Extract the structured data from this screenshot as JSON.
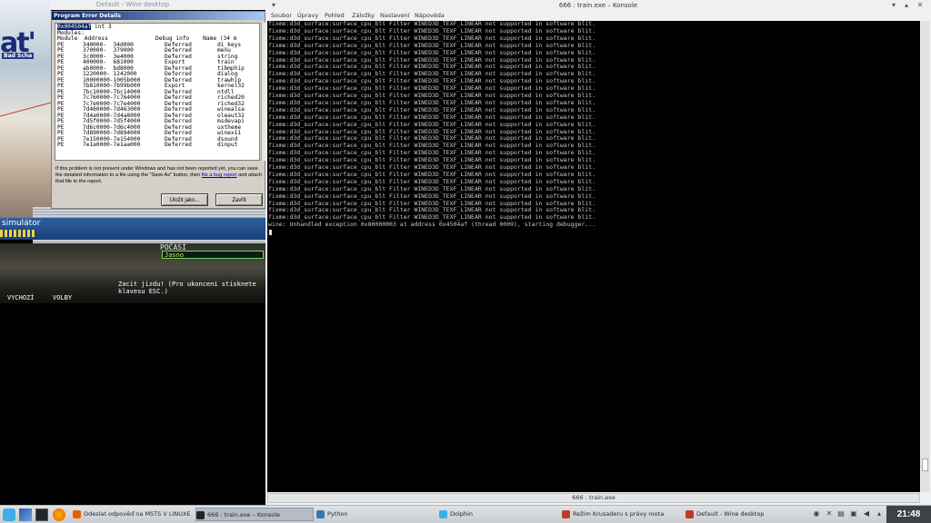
{
  "wine": {
    "window_title": "Default - Wine desktop",
    "game": {
      "logo": "at'",
      "place": "Bad Scha",
      "sim_label": "simulátor",
      "pocasi_label": "POČASÍ",
      "pocasi_value": "Jasno",
      "start_msg": "Zacit jizdu! (Pro ukonceni stisknete\nklavesu ESC.)",
      "vychozi": "VYCHOZÍ",
      "volby": "VOLBY"
    },
    "error_dialog": {
      "title": "Program Error Details",
      "header_addr": "0x004504af",
      "header_rest": " int 3",
      "modules_label": "Modules:",
      "columns_line": "Module  Address              Debug info    Name (34 m",
      "modules": [
        [
          "PE",
          "340000-  34d000",
          "Deferred",
          "di_keys"
        ],
        [
          "PE",
          "370000-  379000",
          "Deferred",
          "menu"
        ],
        [
          "PE",
          "3c0000-  3e4000",
          "Deferred",
          "string"
        ],
        [
          "PE",
          "400000-  681000",
          "Export",
          "train"
        ],
        [
          "PE",
          "ab0000-  bd8000",
          "Deferred",
          "tibmphip"
        ],
        [
          "PE",
          "1220000- 1242000",
          "Deferred",
          "dialog"
        ],
        [
          "PE",
          "10000000-1005b000",
          "Deferred",
          "trawhip"
        ],
        [
          "PE",
          "7b810000-7b99b000",
          "Export",
          "kernel32"
        ],
        [
          "PE",
          "7bc10000-7bc14000",
          "Deferred",
          "ntdll"
        ],
        [
          "PE",
          "7c760000-7c764000",
          "Deferred",
          "riched20"
        ],
        [
          "PE",
          "7c7e0000-7c7e4000",
          "Deferred",
          "riched32"
        ],
        [
          "PE",
          "7d460000-7d463000",
          "Deferred",
          "winealsa"
        ],
        [
          "PE",
          "7d4a0000-7d4a8000",
          "Deferred",
          "oleaut32"
        ],
        [
          "PE",
          "7d5f0000-7d5f4000",
          "Deferred",
          "msdevapi"
        ],
        [
          "PE",
          "7d6c0000-7d6c4000",
          "Deferred",
          "uxtheme"
        ],
        [
          "PE",
          "7d890000-7d894000",
          "Deferred",
          "winex11"
        ],
        [
          "PE",
          "7e150000-7e154000",
          "Deferred",
          "dsound"
        ],
        [
          "PE",
          "7e1a0000-7e1aa000",
          "Deferred",
          "dinput"
        ]
      ],
      "info_text_1": "If this problem is not present under Windows and has not been reported yet, you can save the detailed information to a file using the \"Save As\" button, then ",
      "info_link": "file a bug report",
      "info_text_2": " and attach that file to the report.",
      "save_label": "Uložit jako...",
      "close_label": "Zavřít"
    }
  },
  "konsole": {
    "title": "666 : train.exe – Konsole",
    "menu": [
      "Soubor",
      "Úpravy",
      "Pohled",
      "Záložky",
      "Nastavení",
      "Nápověda"
    ],
    "fixme_line": "fixme:d3d_surface:surface_cpu_blt Filter WINED3D_TEXF_LINEAR not supported in software blit.",
    "fixme_count": 28,
    "last_line": "wine: Unhandled exception 0x80000003 at address 0x4504af (thread 0009), starting debugger...",
    "tab_label": "666 : train.exe"
  },
  "taskbar": {
    "tasks": [
      {
        "label": "Odeslat odpověď na MSTS V LINUXE",
        "color": "#e66000"
      },
      {
        "label": "666 : train.exe – Konsole",
        "color": "#232629",
        "active": true
      },
      {
        "label": "Python",
        "color": "#3776ab"
      },
      {
        "label": "Dolphin",
        "color": "#3daee9"
      },
      {
        "label": "Režim Krusaderu s právy roota",
        "color": "#c0392b"
      },
      {
        "label": "Default - Wine desktop",
        "color": "#c0392b"
      }
    ],
    "clock": "21:48"
  }
}
